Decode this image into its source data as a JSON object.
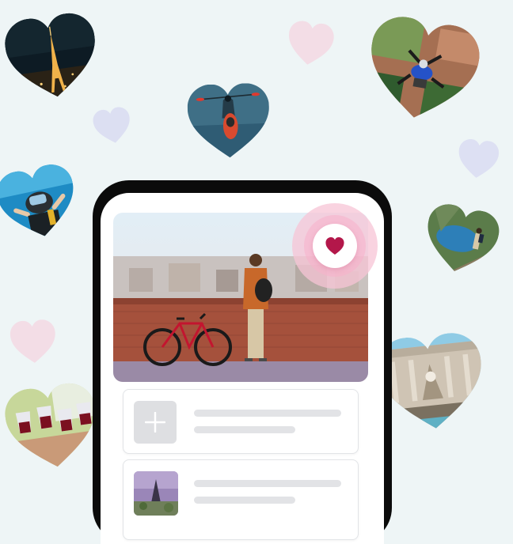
{
  "colors": {
    "background": "#eef5f6",
    "phone_frame": "#0b0b0b",
    "like_heart": "#b3174a",
    "like_glow": "#f7c4d6",
    "placeholder": "#e2e3e6"
  },
  "floating_photos": [
    {
      "name": "eiffel-tower-night",
      "icon": "heart-photo"
    },
    {
      "name": "kayaker-on-lake",
      "icon": "heart-photo"
    },
    {
      "name": "paragliders-over-city",
      "icon": "heart-photo"
    },
    {
      "name": "scuba-diver",
      "icon": "heart-photo"
    },
    {
      "name": "hiker-above-lake",
      "icon": "heart-photo"
    },
    {
      "name": "trevi-fountain",
      "icon": "heart-photo"
    },
    {
      "name": "wine-toast",
      "icon": "heart-photo"
    }
  ],
  "phone": {
    "hero_photo": "cyclist-at-brick-wall-overlooking-city",
    "like_button_icon": "heart-icon",
    "cards": [
      {
        "thumbnail": "add-icon",
        "lines": 2
      },
      {
        "thumbnail": "coastal-rocks-photo",
        "lines": 2
      }
    ]
  }
}
